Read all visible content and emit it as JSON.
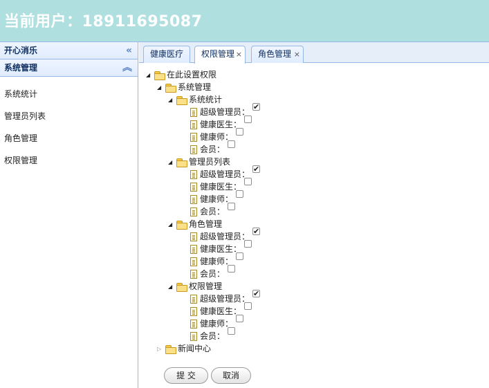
{
  "header": {
    "title": "当前用户：18911695087"
  },
  "sidebar": {
    "panel_title": "开心消乐",
    "collapse_glyph": "«",
    "section_title": "系统管理",
    "section_glyph": "︽",
    "items": [
      {
        "label": "系统统计"
      },
      {
        "label": "管理员列表"
      },
      {
        "label": "角色管理"
      },
      {
        "label": "权限管理"
      }
    ]
  },
  "tabs": [
    {
      "label": "健康医疗",
      "closable": false,
      "active": false
    },
    {
      "label": "权限管理",
      "closable": true,
      "active": true
    },
    {
      "label": "角色管理",
      "closable": true,
      "active": false
    }
  ],
  "tab_close_glyph": "×",
  "tree": {
    "root": "在此设置权限",
    "system": "系统管理",
    "groups": [
      {
        "label": "系统统计",
        "roles": [
          {
            "label": "超级管理员：",
            "checked": true
          },
          {
            "label": "健康医生：",
            "checked": false
          },
          {
            "label": "健康师：",
            "checked": false
          },
          {
            "label": "会员：",
            "checked": false
          }
        ]
      },
      {
        "label": "管理员列表",
        "roles": [
          {
            "label": "超级管理员：",
            "checked": true
          },
          {
            "label": "健康医生：",
            "checked": false
          },
          {
            "label": "健康师：",
            "checked": false
          },
          {
            "label": "会员：",
            "checked": false
          }
        ]
      },
      {
        "label": "角色管理",
        "roles": [
          {
            "label": "超级管理员：",
            "checked": true
          },
          {
            "label": "健康医生：",
            "checked": false
          },
          {
            "label": "健康师：",
            "checked": false
          },
          {
            "label": "会员：",
            "checked": false
          }
        ]
      },
      {
        "label": "权限管理",
        "roles": [
          {
            "label": "超级管理员：",
            "checked": true
          },
          {
            "label": "健康医生：",
            "checked": false
          },
          {
            "label": "健康师：",
            "checked": false
          },
          {
            "label": "会员：",
            "checked": false
          }
        ]
      }
    ],
    "news": "新闻中心"
  },
  "buttons": {
    "submit": "提 交",
    "cancel": "取消"
  }
}
